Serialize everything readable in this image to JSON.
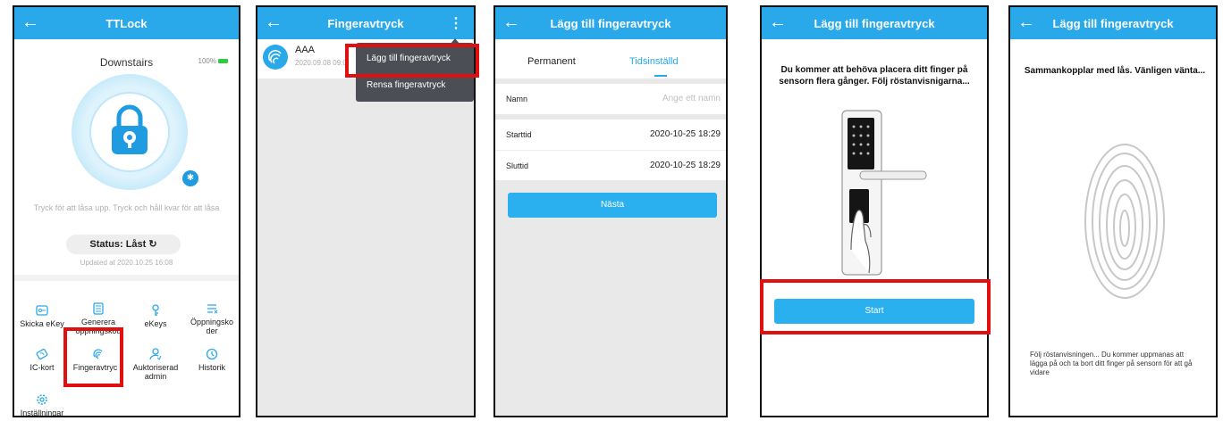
{
  "colors": {
    "accent": "#29a8ea",
    "highlight": "#e01010",
    "panel_bg": "#e9e9e9"
  },
  "screen1": {
    "title": "TTLock",
    "lock_name": "Downstairs",
    "battery": "100%",
    "hint": "Tryck för att låsa upp. Tryck och håll kvar för att låsa",
    "status": "Status:  Låst",
    "updated": "Updated at 2020.10.25 16:08",
    "features": [
      {
        "label": "Skicka eKey",
        "icon": "send-ekey-icon"
      },
      {
        "label": "Generera öppningskod",
        "icon": "keypad-code-icon"
      },
      {
        "label": "eKeys",
        "icon": "ekeys-icon"
      },
      {
        "label": "Öppningsko der",
        "icon": "passcodes-icon"
      },
      {
        "label": "IC-kort",
        "icon": "ic-card-icon"
      },
      {
        "label": "Fingeravtryc k",
        "icon": "fingerprint-icon"
      },
      {
        "label": "Auktoriserad admin",
        "icon": "admin-icon"
      },
      {
        "label": "Historik",
        "icon": "history-icon"
      },
      {
        "label": "Inställningar",
        "icon": "settings-icon"
      }
    ]
  },
  "screen2": {
    "title": "Fingeravtryck",
    "item_name": "AAA",
    "item_date": "2020.09.08 09:0",
    "menu": [
      "Lägg till fingeravtryck",
      "Rensa fingeravtryck"
    ]
  },
  "screen3": {
    "title": "Lägg till fingeravtryck",
    "tabs": [
      "Permanent",
      "Tidsinställd"
    ],
    "name_label": "Namn",
    "name_placeholder": "Ange ett namn",
    "start_label": "Starttid",
    "start_value": "2020-10-25 18:29",
    "end_label": "Sluttid",
    "end_value": "2020-10-25 18:29",
    "next_button": "Nästa"
  },
  "screen4": {
    "title": "Lägg till fingeravtryck",
    "instruction": "Du kommer att behöva placera ditt finger på sensorn flera gånger. Följ röstanvisnigarna...",
    "start_button": "Start"
  },
  "screen5": {
    "title": "Lägg till fingeravtryck",
    "pairing": "Sammankopplar med lås. Vänligen vänta...",
    "follow": "Följ röstanvisningen... Du kommer uppmanas att lägga på och ta bort ditt finger på sensorn för att gå vidare"
  }
}
